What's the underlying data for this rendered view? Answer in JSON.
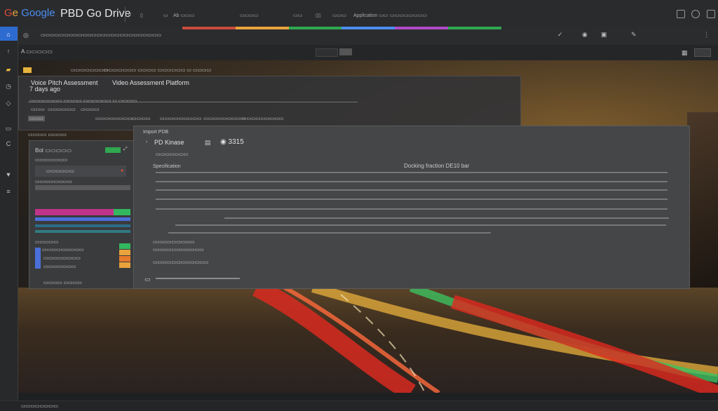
{
  "app": {
    "logo": "Ge Google",
    "title": "PBD Go Drive",
    "menu": [
      "p",
      "▯",
      "▭",
      "Ab ▭▭▭",
      "▭▭▭▭",
      "▭▭",
      "▯▯",
      "▭▭▭",
      "Application ▭▭",
      "▭▭▭▭▭▭▭▭"
    ],
    "url": "▭▭▭▭▭▭▭▭▭▭▭▭▭▭▭▭▭▭▭▭▭▭▭▭▭▭",
    "path": "A ▭▭▭▭▭",
    "brand_colors": [
      "#c84a3c",
      "#e8a33c",
      "#2fa84f",
      "#4b8ef0",
      "#b04ac8",
      "#2fa84f"
    ]
  },
  "panel_a": {
    "breadcrumb": "▭▭▭▭▭▭▭▭",
    "title_1": "Voice Pitch Assessment",
    "title_2": "Video Assessment Platform",
    "subtitle": "7 days ago",
    "sub_info": "▭▭▭▭▭▭▭ ▭▭▭▭ ▭▭▭▭▭▭ ▭ ▭▭▭▭",
    "tabs": [
      "▭▭▭",
      "▭▭▭▭▭▭",
      "▭▭▭▭",
      "▭▭▭▭▭▭▭▭",
      "▭▭▭▭▭▭▭▭▭",
      "▭▭▭▭▭▭▭▭▭"
    ]
  },
  "panel_b": {
    "title": "Bot ▭▭▭▭▭",
    "header_tag": "▭▭",
    "section": "▭▭▭▭ ▭▭▭▭",
    "items": [
      "▭▭▭▭▭▭▭",
      "▭▭▭▭▭▭",
      "▭▭▭▭▭▭▭▭",
      "▭▭▭▭▭",
      "▭▭▭▭▭▭▭▭▭"
    ],
    "legend_colors": [
      "#c0338a",
      "#33b860",
      "#4a6fd8",
      "#2aa8b0",
      "#e8a33c",
      "#e87a2c"
    ]
  },
  "panel_c": {
    "label": "Import PDB",
    "heading": "PD Kinase",
    "sub": "▭▭▭▭▭▭▭",
    "code": "3315",
    "doc_title": "Docking fraction DE10 bar",
    "section_label": "Specification",
    "footer_items": [
      "▭▭▭▭▭▭▭▭▭",
      "▭▭▭▭▭▭▭▭▭▭▭",
      "▭▭▭▭▭▭▭▭▭▭▭▭"
    ]
  },
  "status": {
    "left": "▭▭▭▭▭▭▭▭"
  }
}
